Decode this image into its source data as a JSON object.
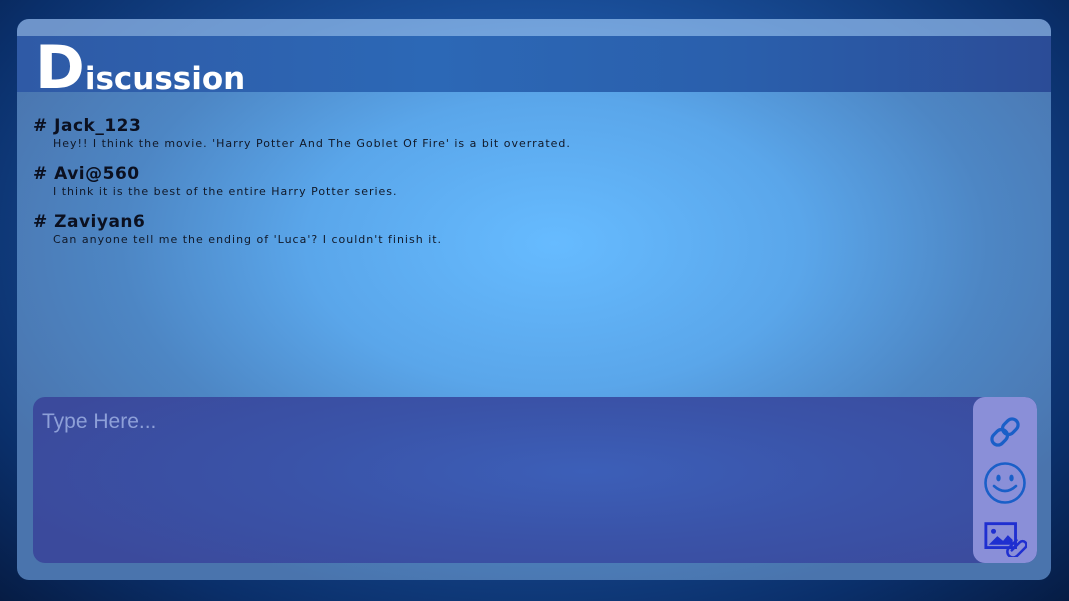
{
  "header": {
    "title_first": "D",
    "title_rest": "iscussion"
  },
  "messages": [
    {
      "user": "# Jack_123",
      "text": "Hey!! I think the movie. 'Harry Potter And The Goblet Of Fire' is a bit overrated."
    },
    {
      "user": "# Avi@560",
      "text": "I think it is the best of the entire Harry Potter series."
    },
    {
      "user": "# Zaviyan6",
      "text": "Can anyone tell me the ending of 'Luca'? I couldn't finish it."
    }
  ],
  "composer": {
    "placeholder": "Type Here..."
  },
  "toolbar": {
    "icons": [
      "link-icon",
      "smiley-icon",
      "image-attach-icon"
    ]
  },
  "colors": {
    "header": "#2c68b6",
    "icon": "#1a5fc8",
    "toolbar": "#8a8fd8"
  }
}
